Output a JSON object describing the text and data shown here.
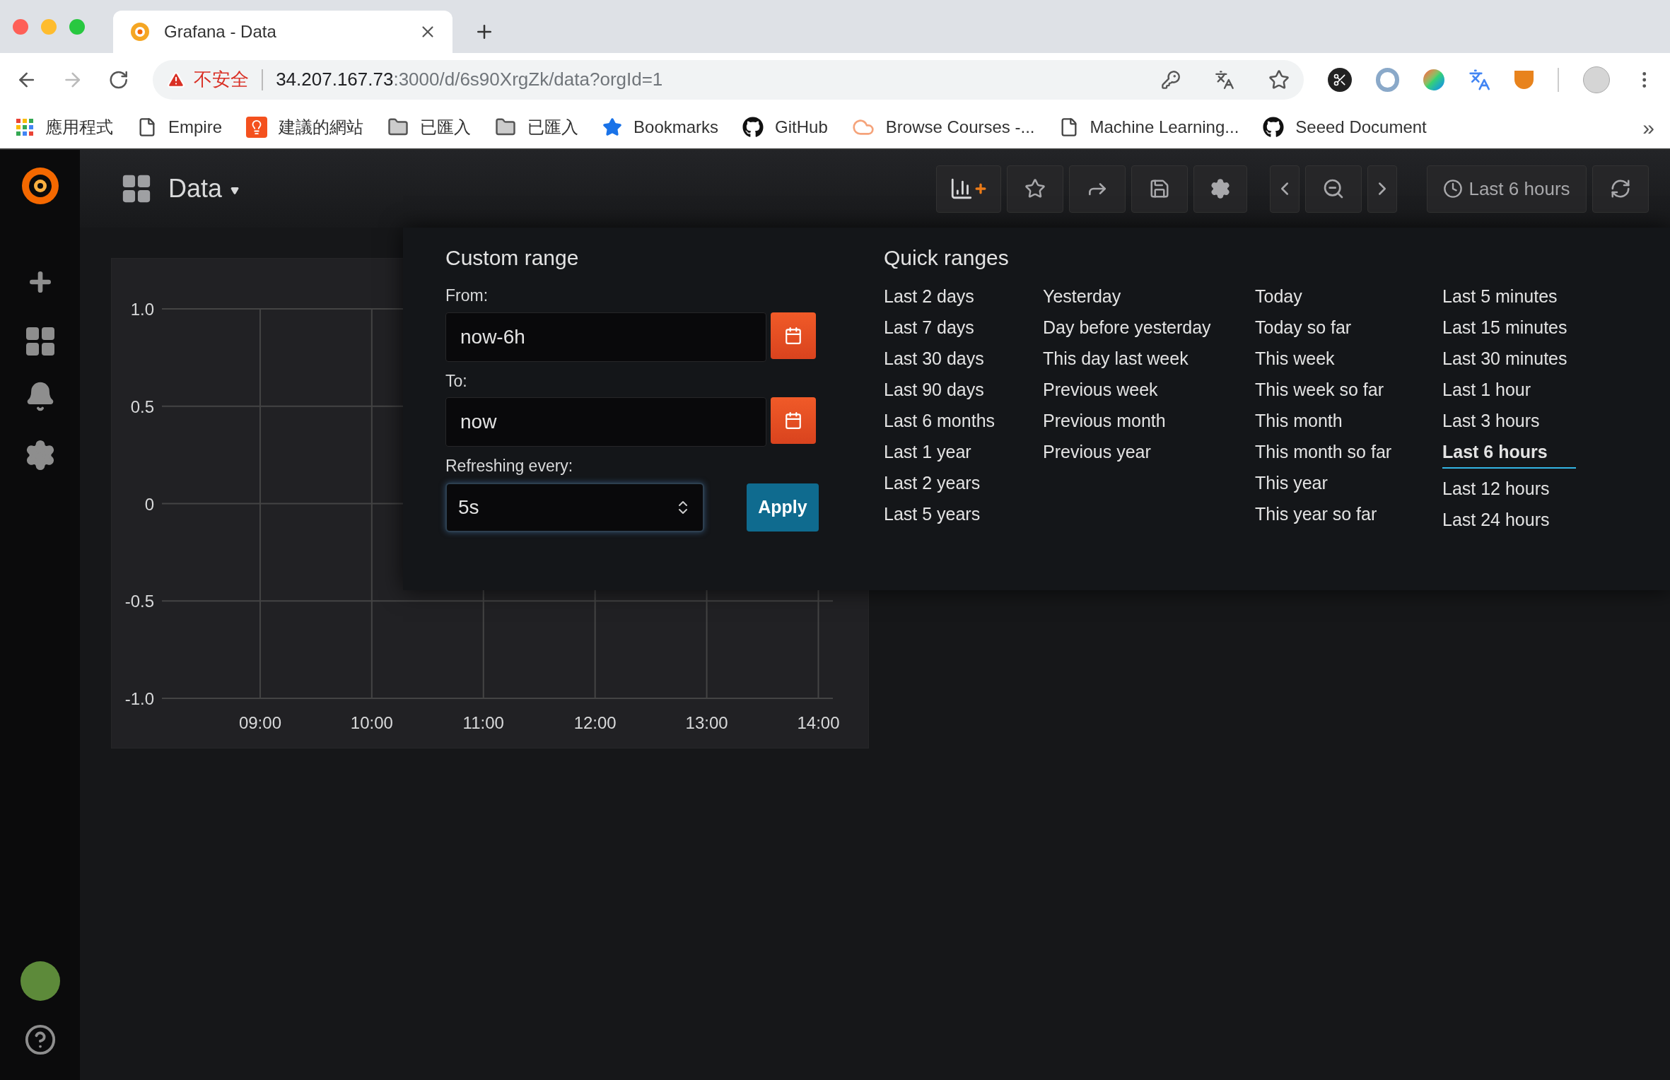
{
  "browser": {
    "tab": {
      "title": "Grafana - Data"
    },
    "address": {
      "warning": "不安全",
      "host": "34.207.167.73",
      "path": ":3000/d/6s90XrgZk/data?orgId=1"
    },
    "bookmarks": [
      {
        "kind": "apps",
        "label": "應用程式"
      },
      {
        "kind": "page",
        "label": "Empire"
      },
      {
        "kind": "bulb",
        "label": "建議的網站"
      },
      {
        "kind": "folder",
        "label": "已匯入"
      },
      {
        "kind": "folder",
        "label": "已匯入"
      },
      {
        "kind": "star",
        "label": "Bookmarks"
      },
      {
        "kind": "github",
        "label": "GitHub"
      },
      {
        "kind": "cloud",
        "label": "Browse Courses -..."
      },
      {
        "kind": "page",
        "label": "Machine Learning..."
      },
      {
        "kind": "github",
        "label": "Seeed Document"
      }
    ],
    "more": "»"
  },
  "dashboard": {
    "title": "Data",
    "time_range": "Last 6 hours"
  },
  "panel": {
    "chart_data": {
      "type": "line",
      "xticks": [
        {
          "value": 9,
          "label": "09:00"
        },
        {
          "value": 10,
          "label": "10:00"
        },
        {
          "value": 11,
          "label": "11:00"
        },
        {
          "value": 12,
          "label": "12:00"
        },
        {
          "value": 13,
          "label": "13:00"
        },
        {
          "value": 14,
          "label": "14:00"
        }
      ],
      "yticks": [
        {
          "value": 1,
          "label": "1.0"
        },
        {
          "value": 0.5,
          "label": "0.5"
        },
        {
          "value": 0,
          "label": "0"
        },
        {
          "value": -0.5,
          "label": "-0.5"
        },
        {
          "value": -1,
          "label": "-1.0"
        }
      ],
      "ylim": [
        -1,
        1
      ],
      "xlim": [
        8.12,
        14.13
      ],
      "grid": true
    }
  },
  "time_picker": {
    "custom_range": {
      "title": "Custom range",
      "from_label": "From:",
      "from_value": "now-6h",
      "to_label": "To:",
      "to_value": "now",
      "refresh_label": "Refreshing every:",
      "refresh_value": "5s",
      "apply": "Apply"
    },
    "quick_ranges": {
      "title": "Quick ranges",
      "columns": [
        [
          {
            "label": "Last 2 days",
            "selected": false
          },
          {
            "label": "Last 7 days",
            "selected": false
          },
          {
            "label": "Last 30 days",
            "selected": false
          },
          {
            "label": "Last 90 days",
            "selected": false
          },
          {
            "label": "Last 6 months",
            "selected": false
          },
          {
            "label": "Last 1 year",
            "selected": false
          },
          {
            "label": "Last 2 years",
            "selected": false
          },
          {
            "label": "Last 5 years",
            "selected": false
          }
        ],
        [
          {
            "label": "Yesterday",
            "selected": false
          },
          {
            "label": "Day before yesterday",
            "selected": false
          },
          {
            "label": "This day last week",
            "selected": false
          },
          {
            "label": "Previous week",
            "selected": false
          },
          {
            "label": "Previous month",
            "selected": false
          },
          {
            "label": "Previous year",
            "selected": false
          }
        ],
        [
          {
            "label": "Today",
            "selected": false
          },
          {
            "label": "Today so far",
            "selected": false
          },
          {
            "label": "This week",
            "selected": false
          },
          {
            "label": "This week so far",
            "selected": false
          },
          {
            "label": "This month",
            "selected": false
          },
          {
            "label": "This month so far",
            "selected": false
          },
          {
            "label": "This year",
            "selected": false
          },
          {
            "label": "This year so far",
            "selected": false
          }
        ],
        [
          {
            "label": "Last 5 minutes",
            "selected": false
          },
          {
            "label": "Last 15 minutes",
            "selected": false
          },
          {
            "label": "Last 30 minutes",
            "selected": false
          },
          {
            "label": "Last 1 hour",
            "selected": false
          },
          {
            "label": "Last 3 hours",
            "selected": false
          },
          {
            "label": "Last 6 hours",
            "selected": true
          },
          {
            "label": "Last 12 hours",
            "selected": false
          },
          {
            "label": "Last 24 hours",
            "selected": false
          }
        ]
      ]
    }
  }
}
